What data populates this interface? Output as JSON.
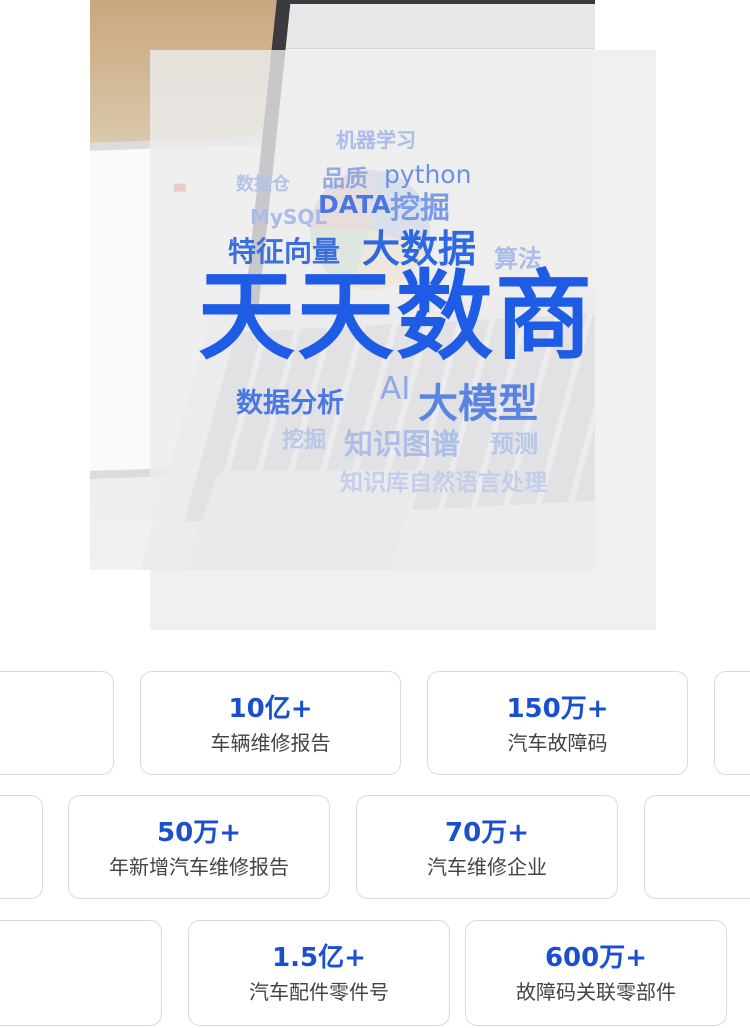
{
  "hero": {
    "word_cloud": {
      "main": "天天数商",
      "words": [
        "大数据",
        "特征向量",
        "python",
        "品质",
        "DATA",
        "挖掘",
        "MySQL",
        "机器学习",
        "数据仓",
        "算法",
        "数据分析",
        "AI",
        "大模型",
        "挖掘",
        "知识图谱",
        "预测",
        "知识库自然语言处理"
      ]
    }
  },
  "stats": {
    "row1": [
      {
        "value": "10亿+",
        "label": "车辆维修报告"
      },
      {
        "value": "150万+",
        "label": "汽车故障码"
      }
    ],
    "row2": [
      {
        "value": "50万+",
        "label": "年新增汽车维修报告"
      },
      {
        "value": "70万+",
        "label": "汽车维修企业"
      }
    ],
    "row3": [
      {
        "value": "1.5亿+",
        "label": "汽车配件零件号"
      },
      {
        "value": "600万+",
        "label": "故障码关联零部件"
      }
    ]
  },
  "colors": {
    "accent": "#1a4fcf",
    "card_border": "#d9dbe0",
    "label_text": "#444444"
  }
}
